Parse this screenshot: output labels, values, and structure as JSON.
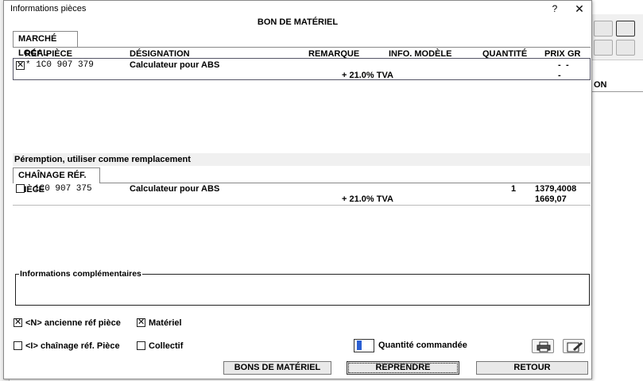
{
  "window": {
    "title": "Informations pièces",
    "help": "?",
    "close": "✕"
  },
  "header": {
    "title": "BON DE MATÉRIEL"
  },
  "background": {
    "right_header": "ON"
  },
  "tab1": {
    "label": "MARCHÉ LOCAL",
    "columns": [
      "RÉF. PIÈCE",
      "DÉSIGNATION",
      "REMARQUE",
      "INFO. MODÈLE",
      "QUANTITÉ",
      "PRIX",
      "GR"
    ],
    "row": {
      "checked": true,
      "ref": "* 1C0 907 379",
      "designation": "Calculateur pour ABS",
      "prix1": "-",
      "gr": "-",
      "tva": "+ 21.0% TVA",
      "prix2": "-"
    }
  },
  "replacement": {
    "section_title": "Péremption, utiliser comme remplacement",
    "tab_label": "CHAÎNAGE RÉF. PIÈCE",
    "row": {
      "checked": false,
      "ref": "1C0 907 375",
      "designation": "Calculateur pour ABS",
      "quantite": "1",
      "prix": "1379,40",
      "gr": "08",
      "tva": "+ 21.0% TVA",
      "prix_tva": "1669,07"
    }
  },
  "info": {
    "label": "Informations complémentaires"
  },
  "options": {
    "ancienne": {
      "label": "<N> ancienne réf pièce",
      "checked": true
    },
    "materiel": {
      "label": "Matériel",
      "checked": true
    },
    "chainage": {
      "label": "<I> chaînage réf. Pièce",
      "checked": false
    },
    "collectif": {
      "label": "Collectif",
      "checked": false
    },
    "quantite_label": "Quantité commandée",
    "quantite_value": "1"
  },
  "buttons": {
    "bons": "BONS DE MATÉRIEL",
    "reprendre": "REPRENDRE",
    "retour": "RETOUR"
  }
}
